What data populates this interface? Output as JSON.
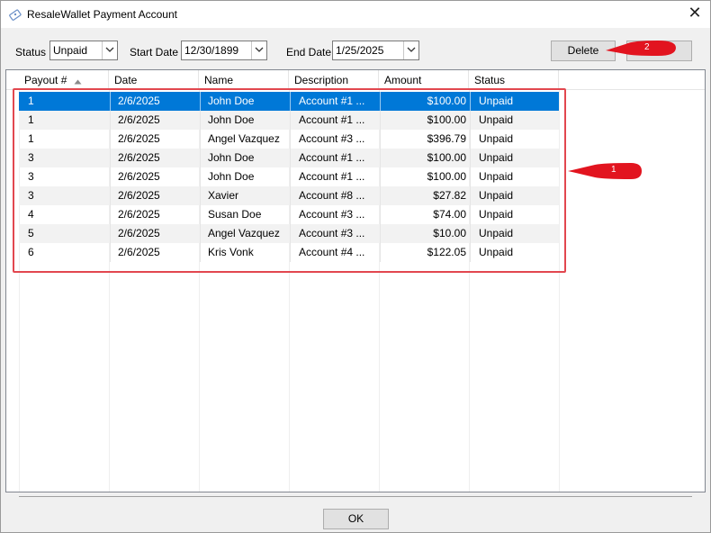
{
  "window": {
    "title": "ResaleWallet Payment Account",
    "icon": "wallet-icon",
    "close_glyph": "✕"
  },
  "filters": {
    "status_label": "Status",
    "status_value": "Unpaid",
    "start_label": "Start Date",
    "start_value": "12/30/1899",
    "end_label": "End Date",
    "end_value": "1/25/2025"
  },
  "toolbar": {
    "delete_label": "Delete",
    "second_label": ""
  },
  "grid": {
    "columns": [
      "Payout #",
      "Date",
      "Name",
      "Description",
      "Amount",
      "Status"
    ],
    "rows": [
      {
        "payout": "1",
        "date": "2/6/2025",
        "name": "John Doe",
        "description": "Account #1 ...",
        "amount": "$100.00",
        "status": "Unpaid"
      },
      {
        "payout": "1",
        "date": "2/6/2025",
        "name": "John Doe",
        "description": "Account #1 ...",
        "amount": "$100.00",
        "status": "Unpaid"
      },
      {
        "payout": "1",
        "date": "2/6/2025",
        "name": "Angel Vazquez",
        "description": "Account #3 ...",
        "amount": "$396.79",
        "status": "Unpaid"
      },
      {
        "payout": "3",
        "date": "2/6/2025",
        "name": "John Doe",
        "description": "Account #1 ...",
        "amount": "$100.00",
        "status": "Unpaid"
      },
      {
        "payout": "3",
        "date": "2/6/2025",
        "name": "John Doe",
        "description": "Account #1 ...",
        "amount": "$100.00",
        "status": "Unpaid"
      },
      {
        "payout": "3",
        "date": "2/6/2025",
        "name": "Xavier",
        "description": "Account #8 ...",
        "amount": "$27.82",
        "status": "Unpaid"
      },
      {
        "payout": "4",
        "date": "2/6/2025",
        "name": "Susan Doe",
        "description": "Account #3 ...",
        "amount": "$74.00",
        "status": "Unpaid"
      },
      {
        "payout": "5",
        "date": "2/6/2025",
        "name": "Angel Vazquez",
        "description": "Account #3 ...",
        "amount": "$10.00",
        "status": "Unpaid"
      },
      {
        "payout": "6",
        "date": "2/6/2025",
        "name": "Kris Vonk",
        "description": "Account #4 ...",
        "amount": "$122.05",
        "status": "Unpaid"
      }
    ]
  },
  "annotations": {
    "callout_1": "1",
    "callout_2": "2"
  },
  "footer": {
    "ok_label": "OK"
  },
  "colors": {
    "selection": "#0078d7",
    "callout": "#e2474f",
    "alt_row": "#f2f2f2"
  }
}
